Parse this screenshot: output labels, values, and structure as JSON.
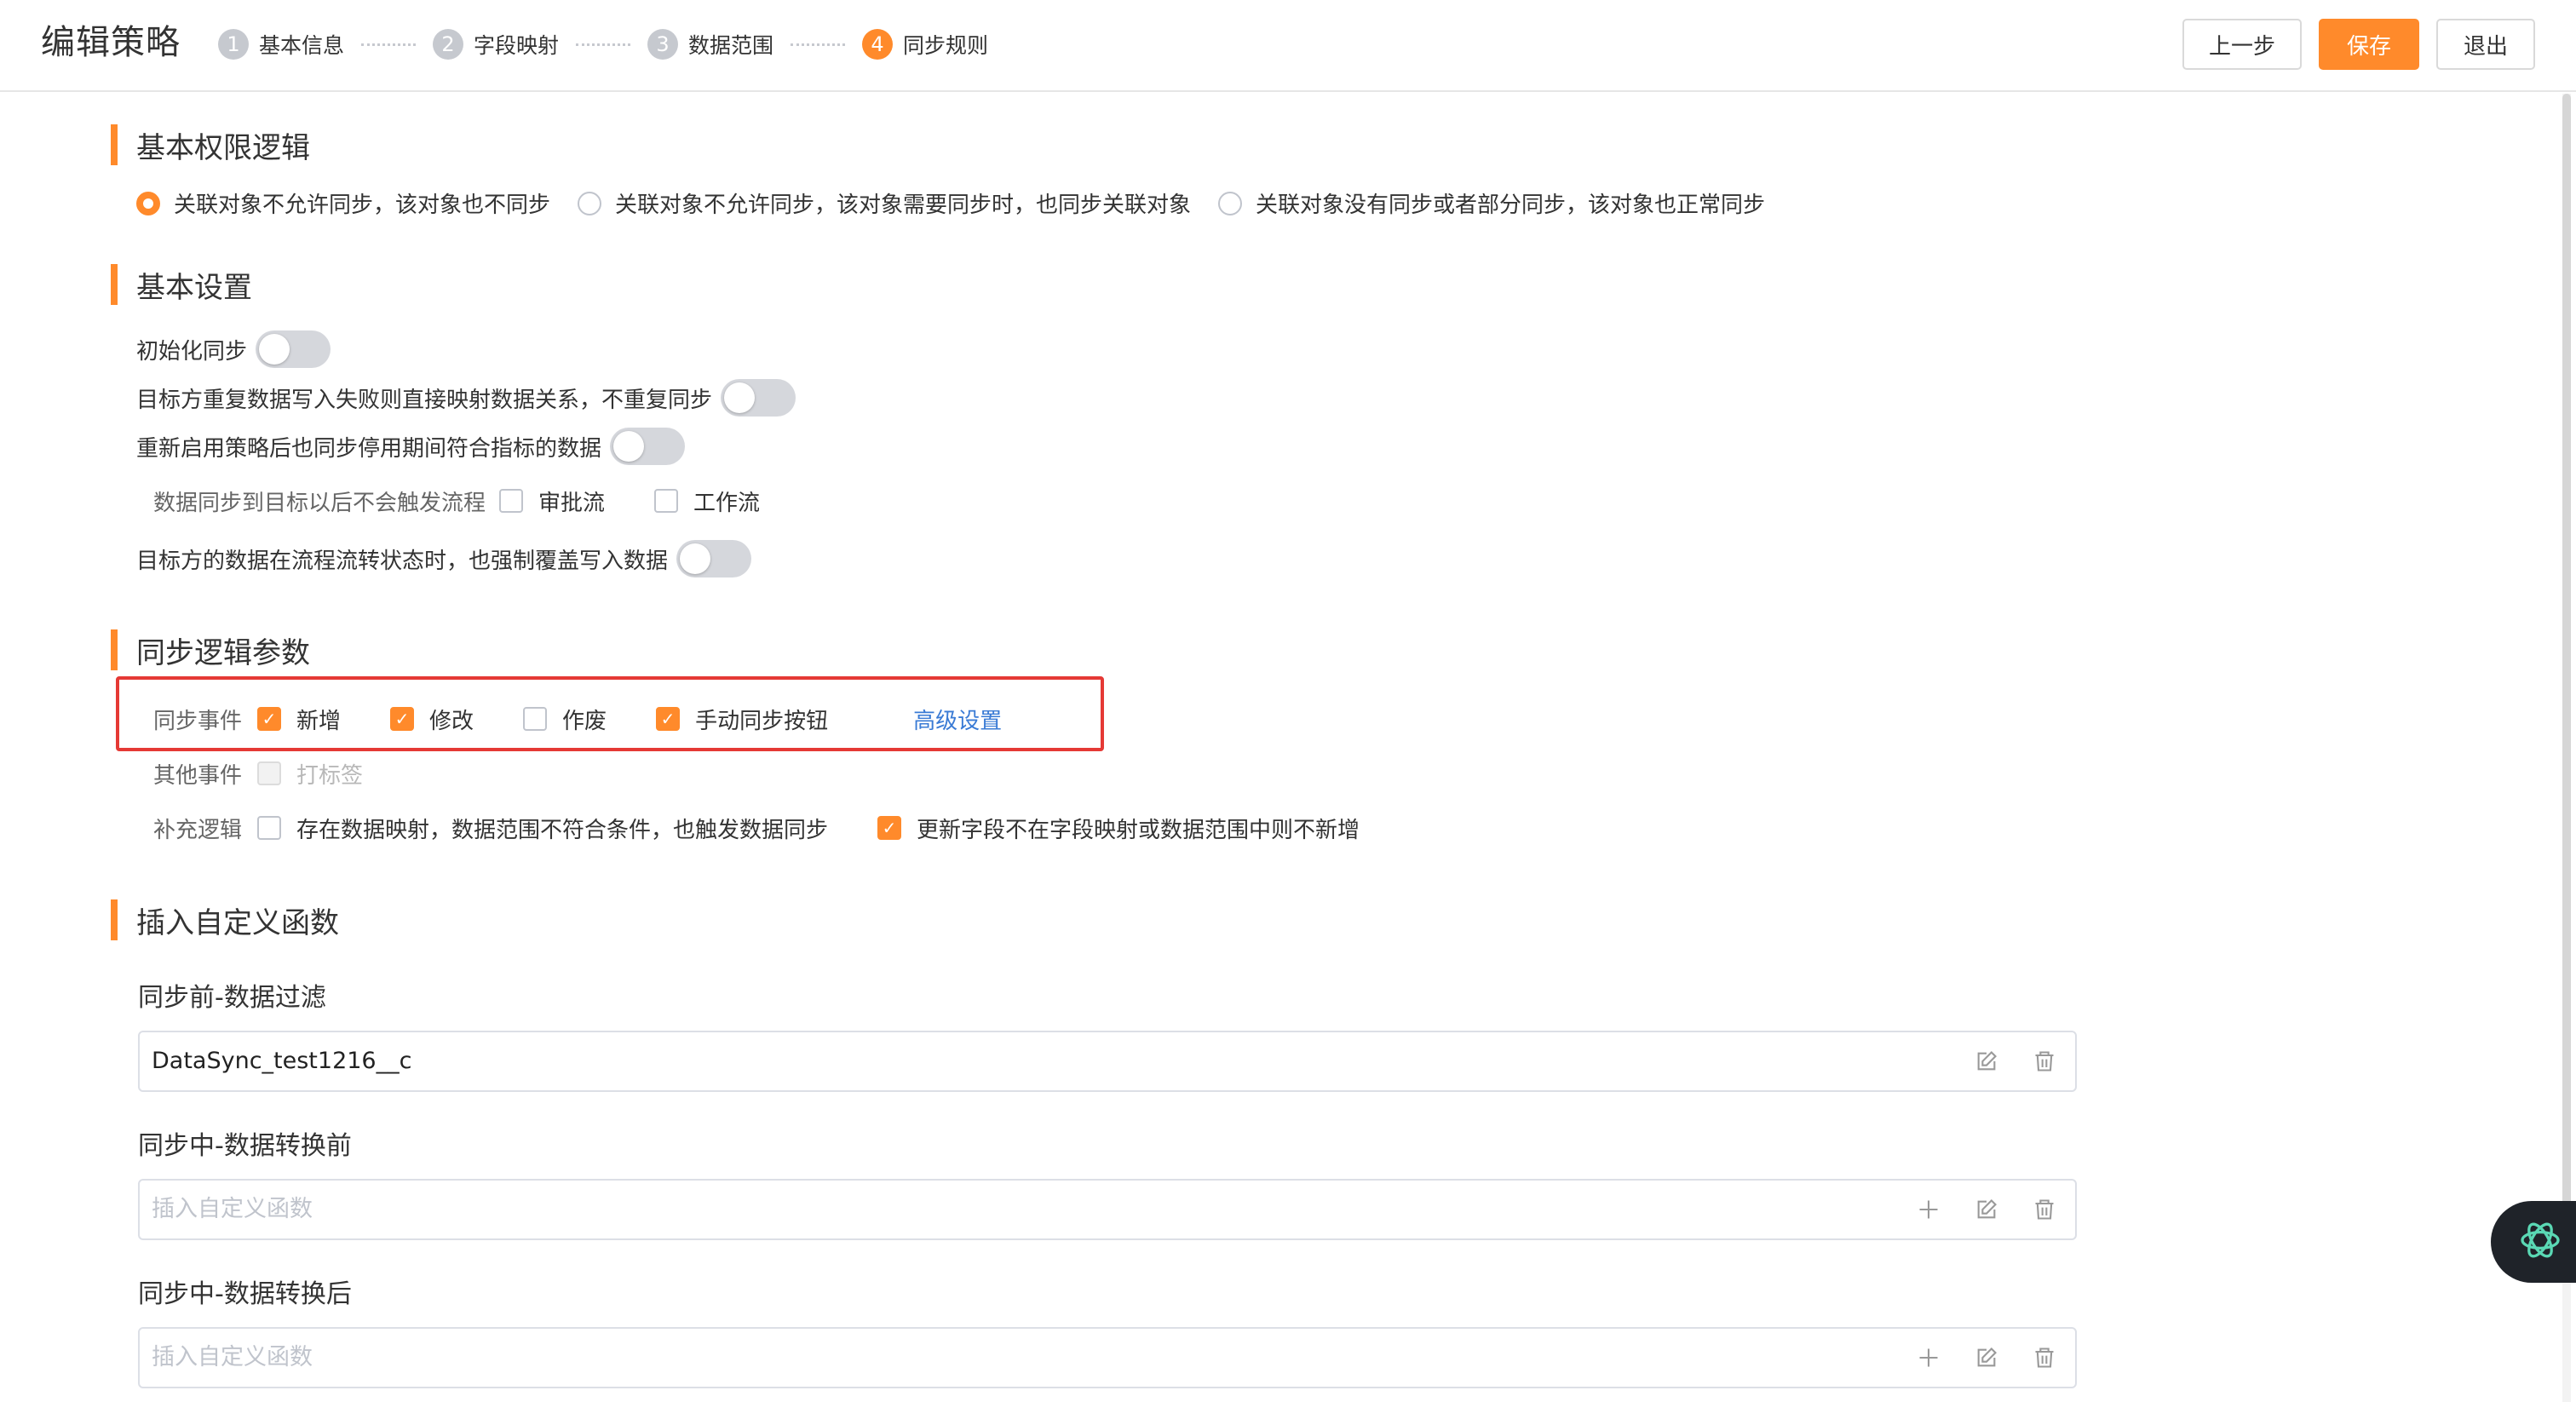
{
  "header": {
    "title": "编辑策略",
    "steps": [
      {
        "num": "1",
        "label": "基本信息"
      },
      {
        "num": "2",
        "label": "字段映射"
      },
      {
        "num": "3",
        "label": "数据范围"
      },
      {
        "num": "4",
        "label": "同步规则"
      }
    ],
    "active_step": 4,
    "buttons": {
      "prev": "上一步",
      "save": "保存",
      "exit": "退出"
    }
  },
  "colors": {
    "accent": "#ff8a2b",
    "highlight_border": "#e53935",
    "link": "#3a7bd5"
  },
  "permission": {
    "title": "基本权限逻辑",
    "options": [
      {
        "label": "关联对象不允许同步，该对象也不同步",
        "checked": true
      },
      {
        "label": "关联对象不允许同步，该对象需要同步时，也同步关联对象",
        "checked": false
      },
      {
        "label": "关联对象没有同步或者部分同步，该对象也正常同步",
        "checked": false
      }
    ]
  },
  "basic": {
    "title": "基本设置",
    "init_sync": {
      "label": "初始化同步",
      "on": false
    },
    "no_repeat": {
      "label": "目标方重复数据写入失败则直接映射数据关系，不重复同步",
      "on": false
    },
    "restart_sync": {
      "label": "重新启用策略后也同步停用期间符合指标的数据",
      "on": false
    },
    "no_trigger": {
      "label": "数据同步到目标以后不会触发流程",
      "options": [
        {
          "label": "审批流",
          "checked": false
        },
        {
          "label": "工作流",
          "checked": false
        }
      ]
    },
    "force_overwrite": {
      "label": "目标方的数据在流程流转状态时，也强制覆盖写入数据",
      "on": false
    }
  },
  "sync_logic": {
    "title": "同步逻辑参数",
    "events": {
      "label": "同步事件",
      "options": [
        {
          "label": "新增",
          "checked": true
        },
        {
          "label": "修改",
          "checked": true
        },
        {
          "label": "作废",
          "checked": false
        },
        {
          "label": "手动同步按钮",
          "checked": true
        }
      ],
      "advanced_link": "高级设置"
    },
    "other_events": {
      "label": "其他事件",
      "options": [
        {
          "label": "打标签",
          "checked": false,
          "disabled": true
        }
      ]
    },
    "supplement": {
      "label": "补充逻辑",
      "options": [
        {
          "label": "存在数据映射，数据范围不符合条件，也触发数据同步",
          "checked": false
        },
        {
          "label": "更新字段不在字段映射或数据范围中则不新增",
          "checked": true
        }
      ]
    }
  },
  "custom_functions": {
    "title": "插入自定义函数",
    "fields": [
      {
        "label": "同步前-数据过滤",
        "value": "DataSync_test1216__c",
        "placeholder": ""
      },
      {
        "label": "同步中-数据转换前",
        "value": "",
        "placeholder": "插入自定义函数"
      },
      {
        "label": "同步中-数据转换后",
        "value": "",
        "placeholder": "插入自定义函数"
      }
    ]
  },
  "icons": {
    "edit": "edit-icon",
    "delete": "trash-icon",
    "add": "plus-icon",
    "assistant": "openai-logo-icon"
  }
}
